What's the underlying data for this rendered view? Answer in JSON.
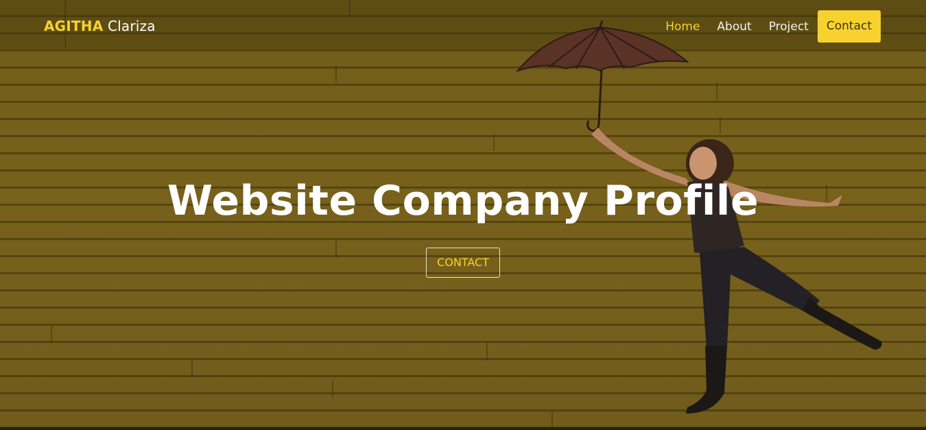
{
  "brand": {
    "first": "AGITHA",
    "second": "Clariza"
  },
  "nav": {
    "items": [
      {
        "label": "Home",
        "active": true
      },
      {
        "label": "About",
        "active": false
      },
      {
        "label": "Project",
        "active": false
      }
    ],
    "contact_label": "Contact"
  },
  "hero": {
    "headline": "Website Company Profile",
    "cta_label": "CONTACT"
  },
  "colors": {
    "accent": "#f7d22e",
    "background": "#7a651e",
    "text": "#ffffff"
  }
}
